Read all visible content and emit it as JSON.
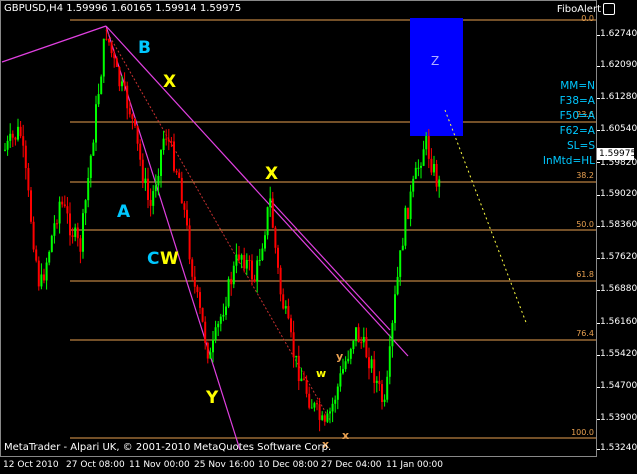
{
  "symbol_header": "GBPUSD,H4  1.59996 1.60165 1.59914 1.59975",
  "indicator_name": "FiboAlert",
  "footer_text": "MetaTrader - Alpari UK, © 2001-2010 MetaQuotes Software Corp.",
  "current_price": "1.59975",
  "price_axis": [
    "1.62740",
    "1.62090",
    "1.61280",
    "1.60540",
    "1.59820",
    "1.59020",
    "1.58360",
    "1.57620",
    "1.56880",
    "1.56160",
    "1.55420",
    "1.54700",
    "1.53900",
    "1.53240"
  ],
  "time_axis": [
    "12 Oct 2010",
    "27 Oct 08:00",
    "11 Nov 00:00",
    "25 Nov 16:00",
    "10 Dec 08:00",
    "27 Dec 04:00",
    "11 Jan 00:00"
  ],
  "fibo_levels": [
    "0.0",
    "23.6",
    "38.2",
    "50.0",
    "61.8",
    "76.4",
    "100.0"
  ],
  "wave_labels": {
    "B": "B",
    "X_upper": "X",
    "A": "A",
    "X_mid": "X",
    "C": "C",
    "W": "W",
    "Y": "Y",
    "small_y": "y",
    "small_w": "w",
    "small_x1": "x",
    "small_x2": "x"
  },
  "target_zone_label": "Z",
  "indicator_params": [
    "MM=N",
    "F38=A",
    "F50=A",
    "F62=A",
    "SL=S",
    "InMtd=HL"
  ],
  "colors": {
    "background": "#000000",
    "bull_candle": "#00ff00",
    "bear_candle": "#ff0000",
    "channel": "#e040e0",
    "fibo": "#e8a050",
    "target_zone": "#0000ff",
    "wave_upper": "#ffff00",
    "wave_lower": "#00c8ff",
    "params": "#00c8ff"
  }
}
